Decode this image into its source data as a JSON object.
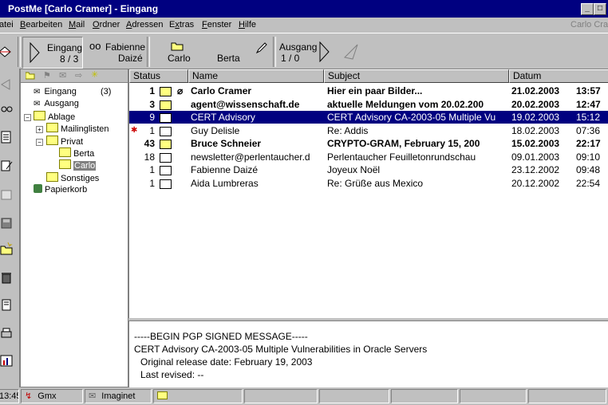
{
  "window": {
    "title": "PostMe [Carlo Cramer] - Eingang",
    "user": "Carlo Cramer",
    "min_btn": "_",
    "max_btn": "□"
  },
  "menu": [
    {
      "pre": "",
      "u": "",
      "post": "atei"
    },
    {
      "pre": "",
      "u": "B",
      "post": "earbeiten"
    },
    {
      "pre": "",
      "u": "M",
      "post": "ail"
    },
    {
      "pre": "",
      "u": "O",
      "post": "rdner"
    },
    {
      "pre": "",
      "u": "A",
      "post": "dressen"
    },
    {
      "pre": "E",
      "u": "x",
      "post": "tras"
    },
    {
      "pre": "",
      "u": "F",
      "post": "enster"
    },
    {
      "pre": "",
      "u": "H",
      "post": "ilfe"
    }
  ],
  "toolbar": {
    "eingang_label": "Eingang",
    "eingang_count": "8 / 3",
    "fabienne_label": "Fabienne",
    "fabienne_sub": "Daizé",
    "carlo_label": "Carlo",
    "berta_label": "Berta",
    "ausgang_label": "Ausgang",
    "ausgang_count": "1 / 0"
  },
  "folders": {
    "eingang": "Eingang",
    "eingang_count": "(3)",
    "ausgang": "Ausgang",
    "ablage": "Ablage",
    "mailinglisten": "Mailinglisten",
    "privat": "Privat",
    "berta": "Berta",
    "carlo": "Carlo",
    "sonstiges": "Sonstiges",
    "papierkorb": "Papierkorb",
    "expand_plus": "+",
    "expand_minus": "−"
  },
  "columns": {
    "status": "Status",
    "name": "Name",
    "subject": "Subject",
    "datum": "Datum"
  },
  "messages": [
    {
      "num": "1",
      "name": "Carlo Cramer",
      "subject": "Hier ein paar Bilder...",
      "date": "21.02.2003",
      "time": "13:57",
      "bold": true,
      "icon": "new-mail-icon"
    },
    {
      "num": "3",
      "name": "agent@wissenschaft.de",
      "subject": "aktuelle Meldungen vom 20.02.200",
      "date": "20.02.2003",
      "time": "12:47",
      "bold": true,
      "icon": "new-mail-icon"
    },
    {
      "num": "9",
      "name": "CERT Advisory",
      "subject": "CERT Advisory CA-2003-05 Multiple Vu",
      "date": "19.02.2003",
      "time": "15:12",
      "bold": false,
      "icon": "read-mail-icon"
    },
    {
      "num": "1",
      "name": "Guy Delisle",
      "subject": "Re: Addis",
      "date": "18.02.2003",
      "time": "07:36",
      "bold": false,
      "icon": "read-mail-icon"
    },
    {
      "num": "43",
      "name": "Bruce Schneier",
      "subject": "CRYPTO-GRAM, February 15, 200",
      "date": "15.02.2003",
      "time": "22:17",
      "bold": true,
      "icon": "new-mail-icon"
    },
    {
      "num": "18",
      "name": "newsletter@perlentaucher.d",
      "subject": "Perlentaucher Feuilletonrundschau",
      "date": "09.01.2003",
      "time": "09:10",
      "bold": false,
      "icon": "read-mail-icon"
    },
    {
      "num": "1",
      "name": "Fabienne Daizé",
      "subject": "Joyeux Noël",
      "date": "23.12.2002",
      "time": "09:48",
      "bold": false,
      "icon": "read-mail-icon"
    },
    {
      "num": "1",
      "name": "Aida Lumbreras",
      "subject": "Re: Grüße aus Mexico",
      "date": "20.12.2002",
      "time": "22:54",
      "bold": false,
      "icon": "read-mail-icon"
    }
  ],
  "preview": {
    "line1": "-----BEGIN PGP SIGNED MESSAGE-----",
    "line2": "CERT Advisory CA-2003-05 Multiple Vulnerabilities in Oracle Servers",
    "line3": "Original release date: February 19, 2003",
    "line4": "Last revised: --"
  },
  "statusbar": {
    "time": "13:45",
    "gmx": "Gmx",
    "imaginet": "Imaginet"
  },
  "colors": {
    "title_bg": "#000080",
    "selection": "#000080",
    "folder": "#ffff80"
  }
}
